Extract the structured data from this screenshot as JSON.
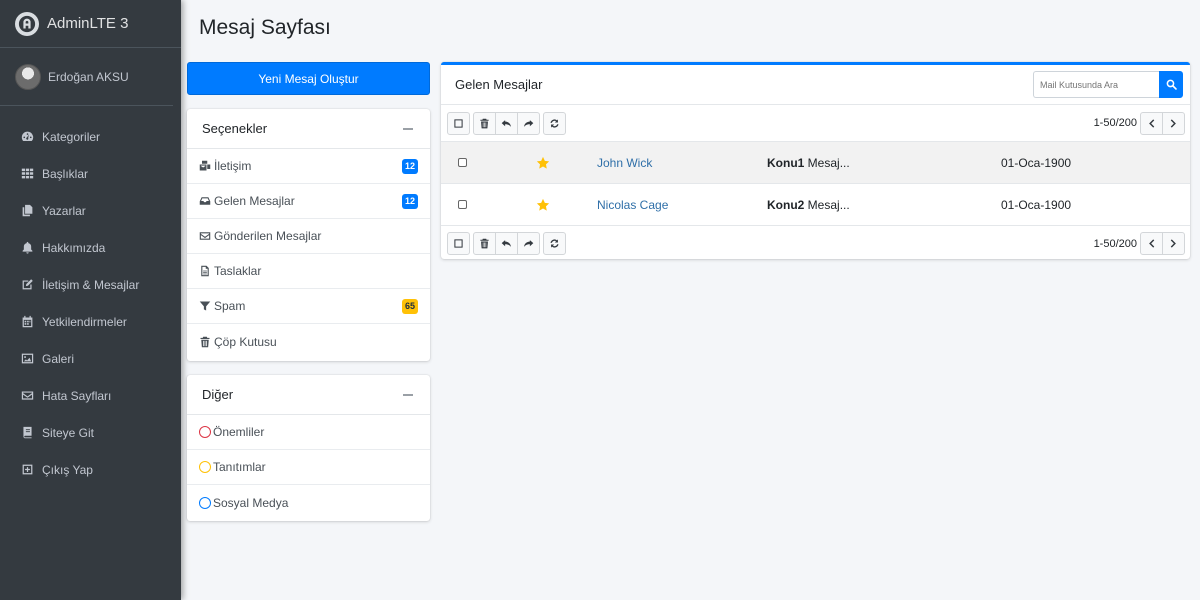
{
  "brand": {
    "name": "AdminLTE 3"
  },
  "user": {
    "name": "Erdoğan AKSU"
  },
  "sidebar": {
    "items": [
      {
        "label": "Kategoriler",
        "icon": "tachometer-icon"
      },
      {
        "label": "Başlıklar",
        "icon": "grid-icon"
      },
      {
        "label": "Yazarlar",
        "icon": "copy-icon"
      },
      {
        "label": "Hakkımızda",
        "icon": "bell-icon"
      },
      {
        "label": "İletişim & Mesajlar",
        "icon": "edit-icon"
      },
      {
        "label": "Yetkilendirmeler",
        "icon": "calendar-icon"
      },
      {
        "label": "Galeri",
        "icon": "image-icon"
      },
      {
        "label": "Hata Sayfları",
        "icon": "envelope-icon"
      },
      {
        "label": "Siteye Git",
        "icon": "book-icon"
      },
      {
        "label": "Çıkış Yap",
        "icon": "plus-square-icon"
      }
    ]
  },
  "page": {
    "title": "Mesaj Sayfası"
  },
  "compose": {
    "label": "Yeni Mesaj Oluştur"
  },
  "options": {
    "title": "Seçenekler",
    "items": [
      {
        "label": "İletişim",
        "icon": "mail-bulk-icon",
        "badge": "12",
        "badge_color": "#007bff"
      },
      {
        "label": "Gelen Mesajlar",
        "icon": "inbox-icon",
        "badge": "12",
        "badge_color": "#007bff"
      },
      {
        "label": "Gönderilen Mesajlar",
        "icon": "envelope-outline-icon",
        "badge": "",
        "badge_color": ""
      },
      {
        "label": "Taslaklar",
        "icon": "file-alt-icon",
        "badge": "",
        "badge_color": ""
      },
      {
        "label": "Spam",
        "icon": "filter-icon",
        "badge": "65",
        "badge_color": "#ffc107"
      },
      {
        "label": "Çöp Kutusu",
        "icon": "trash-icon",
        "badge": "",
        "badge_color": ""
      }
    ]
  },
  "other": {
    "title": "Diğer",
    "items": [
      {
        "label": "Önemliler",
        "color": "#dc3545"
      },
      {
        "label": "Tanıtımlar",
        "color": "#ffc107"
      },
      {
        "label": "Sosyal Medya",
        "color": "#007bff"
      }
    ]
  },
  "mailbox": {
    "title": "Gelen Mesajlar",
    "search_placeholder": "Mail Kutusunda Ara",
    "pager": "1-50/200",
    "messages": [
      {
        "sender": "John Wick",
        "subject_bold": "Konu1",
        "subject_rest": " Mesaj...",
        "date": "01-Oca-1900",
        "starred": true
      },
      {
        "sender": "Nicolas Cage",
        "subject_bold": "Konu2",
        "subject_rest": " Mesaj...",
        "date": "01-Oca-1900",
        "starred": true
      }
    ]
  },
  "colors": {
    "primary": "#007bff",
    "sidebar": "#343a40",
    "star": "#ffc107",
    "link": "#2f6fa8"
  }
}
